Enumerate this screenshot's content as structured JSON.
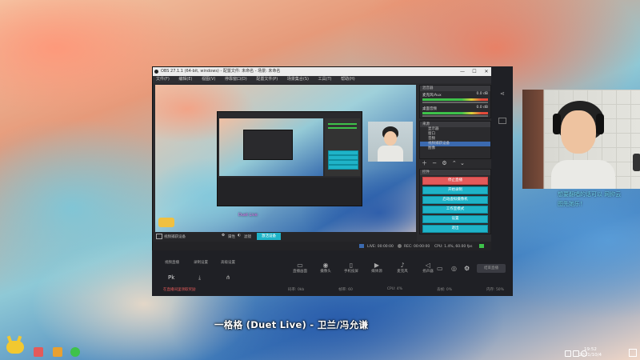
{
  "obs": {
    "title": "OBS 27.1.1 (64-bit, windows) - 配置文件: 未命名 - 场景: 未命名",
    "menu": [
      "文件(F)",
      "编辑(E)",
      "视图(V)",
      "停靠窗口(D)",
      "配置文件(P)",
      "场景集合(S)",
      "工具(T)",
      "帮助(H)"
    ],
    "window_buttons": [
      "—",
      "☐",
      "✕"
    ],
    "mixer_title": "混音器",
    "audio_tracks": [
      {
        "name": "麦克风/Aux",
        "db": "0.0 dB"
      },
      {
        "name": "桌面音频",
        "db": "0.0 dB"
      }
    ],
    "sources_title": "来源",
    "sources": [
      "显示器",
      "窗口",
      "音频",
      "视频捕获设备",
      "图像"
    ],
    "controls_title": "控件",
    "controls": [
      "停止直播",
      "开始录制",
      "启动虚拟摄像机",
      "工作室模式",
      "设置",
      "退出"
    ],
    "status": {
      "dropped": "",
      "live": "LIVE: 00:00:00",
      "rec": "REC: 00:00:00",
      "cpu": "CPU: 1.4%, 60.00 fps"
    },
    "bottom": {
      "source_name": "视频捕获设备",
      "properties": "属性",
      "filters": "滤镜",
      "activate": "激活设备"
    },
    "nested_caption": "Duet Live"
  },
  "app": {
    "tabs": [
      "视频直播",
      "录制设置",
      "高级设置"
    ],
    "tools": [
      "直播画面",
      "摄像头",
      "手机投屏",
      "媒体源",
      "麦克风",
      "扬声器"
    ],
    "left_tools": [
      "Pk",
      "下载",
      "分享"
    ],
    "banner_text": "在直播间里领取奖励",
    "end_button": "结束直播",
    "stats": [
      "码率: 0kb",
      "帧率: 60",
      "CPU: 4%",
      "丢帧: 0%",
      "内存: 50%"
    ]
  },
  "webcam": {
    "danmu": [
      "想要翻唱的话可以 网抑云",
      "图先她乐！"
    ]
  },
  "caption": "一格格 (Duet Live) - 卫兰/冯允谦",
  "taskbar": {
    "time": "19:52",
    "date": "2021/10/4"
  },
  "colors": {
    "accent": "#1fb3c8",
    "obs_bg": "#2b2b2e",
    "danmu": "#6fd3ef"
  }
}
